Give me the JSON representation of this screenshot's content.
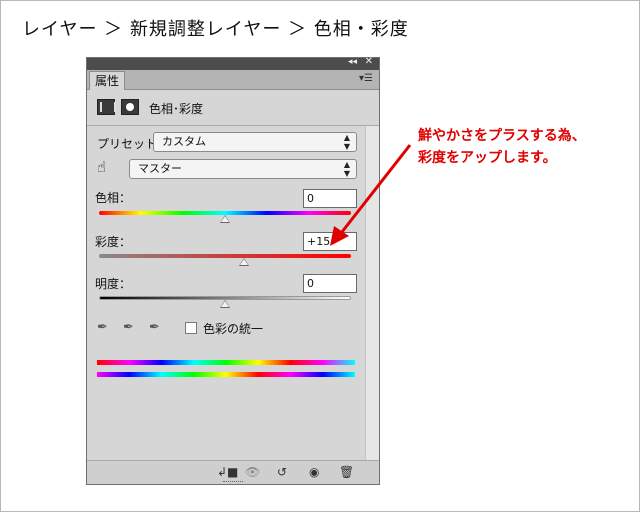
{
  "breadcrumb": "レイヤー ＞ 新規調整レイヤー ＞ 色相・彩度",
  "panel": {
    "tab": "属性",
    "title": "色相･彩度",
    "preset_label": "プリセット：",
    "preset_value": "カスタム",
    "channel_value": "マスター",
    "hue": {
      "label": "色相：",
      "value": "0",
      "level": 0.5
    },
    "saturation": {
      "label": "彩度：",
      "value": "+15",
      "level": 0.575
    },
    "lightness": {
      "label": "明度：",
      "value": "0",
      "level": 0.5
    },
    "colorize_label": "色彩の統一"
  },
  "annotation": {
    "line1": "鮮やかさをプラスする為、",
    "line2": "彩度をアップします。",
    "color": "#e00000"
  },
  "icons": [
    "collapse-icon",
    "close-icon",
    "panel-menu-icon",
    "adjustment-icon",
    "mask-icon",
    "hand-target-icon",
    "eyedropper-icon",
    "eyedropper-plus-icon",
    "eyedropper-minus-icon",
    "clip-to-layer-icon",
    "view-previous-icon",
    "reset-icon",
    "visibility-icon",
    "trash-icon"
  ]
}
